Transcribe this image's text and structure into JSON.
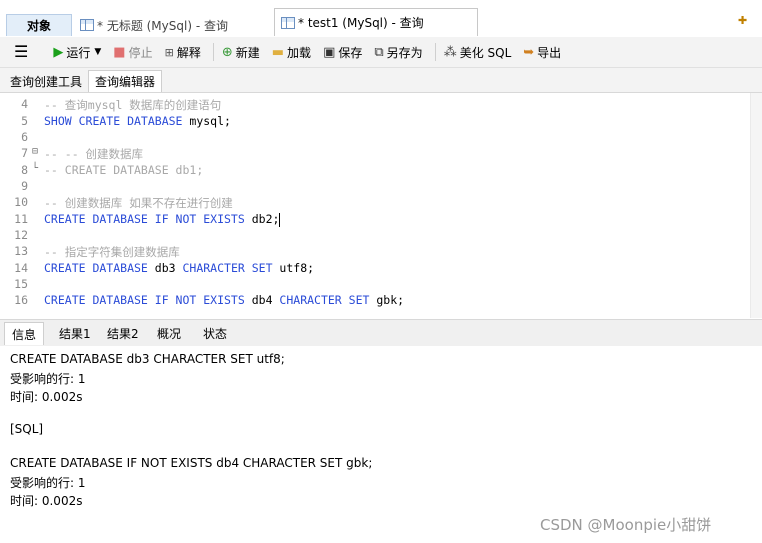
{
  "tabs": {
    "objects": "对象",
    "untitled": "* 无标题 (MySql) - 查询",
    "test1": "* test1 (MySql) - 查询"
  },
  "toolbar": {
    "menu_icon": "menu-icon",
    "run": "运行",
    "stop": "停止",
    "explain": "解释",
    "new": "新建",
    "load": "加载",
    "save": "保存",
    "save_as": "另存为",
    "beautify": "美化 SQL",
    "export": "导出"
  },
  "subtabs": {
    "query_builder": "查询创建工具",
    "query_editor": "查询编辑器"
  },
  "editor": {
    "lines": [
      {
        "n": "4",
        "segments": [
          {
            "t": "-- 查询mysql 数据库的创建语句",
            "c": "cm"
          }
        ]
      },
      {
        "n": "5",
        "segments": [
          {
            "t": "SHOW CREATE DATABASE ",
            "c": "kw"
          },
          {
            "t": "mysql;",
            "c": "id"
          }
        ]
      },
      {
        "n": "6",
        "segments": []
      },
      {
        "n": "7",
        "segments": [
          {
            "t": "-- -- 创建数据库",
            "c": "cm"
          }
        ]
      },
      {
        "n": "8",
        "segments": [
          {
            "t": "-- CREATE DATABASE db1;",
            "c": "cm"
          }
        ]
      },
      {
        "n": "9",
        "segments": []
      },
      {
        "n": "10",
        "segments": [
          {
            "t": "-- 创建数据库 如果不存在进行创建",
            "c": "cm"
          }
        ]
      },
      {
        "n": "11",
        "segments": [
          {
            "t": "CREATE DATABASE IF NOT EXISTS ",
            "c": "kw"
          },
          {
            "t": "db2;",
            "c": "id"
          }
        ]
      },
      {
        "n": "12",
        "segments": []
      },
      {
        "n": "13",
        "segments": [
          {
            "t": "-- 指定字符集创建数据库",
            "c": "cm"
          }
        ]
      },
      {
        "n": "14",
        "segments": [
          {
            "t": "CREATE DATABASE ",
            "c": "kw"
          },
          {
            "t": "db3 ",
            "c": "id"
          },
          {
            "t": "CHARACTER SET ",
            "c": "kw"
          },
          {
            "t": "utf8;",
            "c": "id"
          }
        ]
      },
      {
        "n": "15",
        "segments": []
      },
      {
        "n": "16",
        "segments": [
          {
            "t": "CREATE DATABASE IF NOT EXISTS ",
            "c": "kw"
          },
          {
            "t": "db4 ",
            "c": "id"
          },
          {
            "t": "CHARACTER SET ",
            "c": "kw"
          },
          {
            "t": "gbk;",
            "c": "id"
          }
        ]
      }
    ]
  },
  "result_tabs": [
    "信息",
    "结果1",
    "结果2",
    "概况",
    "状态"
  ],
  "messages": [
    "CREATE DATABASE db3 CHARACTER SET utf8;",
    "受影响的行: 1",
    "时间: 0.002s",
    "",
    "[SQL]",
    "",
    "CREATE DATABASE IF NOT EXISTS db4 CHARACTER SET gbk;",
    "受影响的行: 1",
    "时间: 0.002s"
  ],
  "watermark": "CSDN @Moonpie小甜饼",
  "colors": {
    "keyword": "#2a4bd7",
    "comment": "#a8a8a8",
    "run_icon": "#1aa01a",
    "stop_icon": "#e07070"
  }
}
